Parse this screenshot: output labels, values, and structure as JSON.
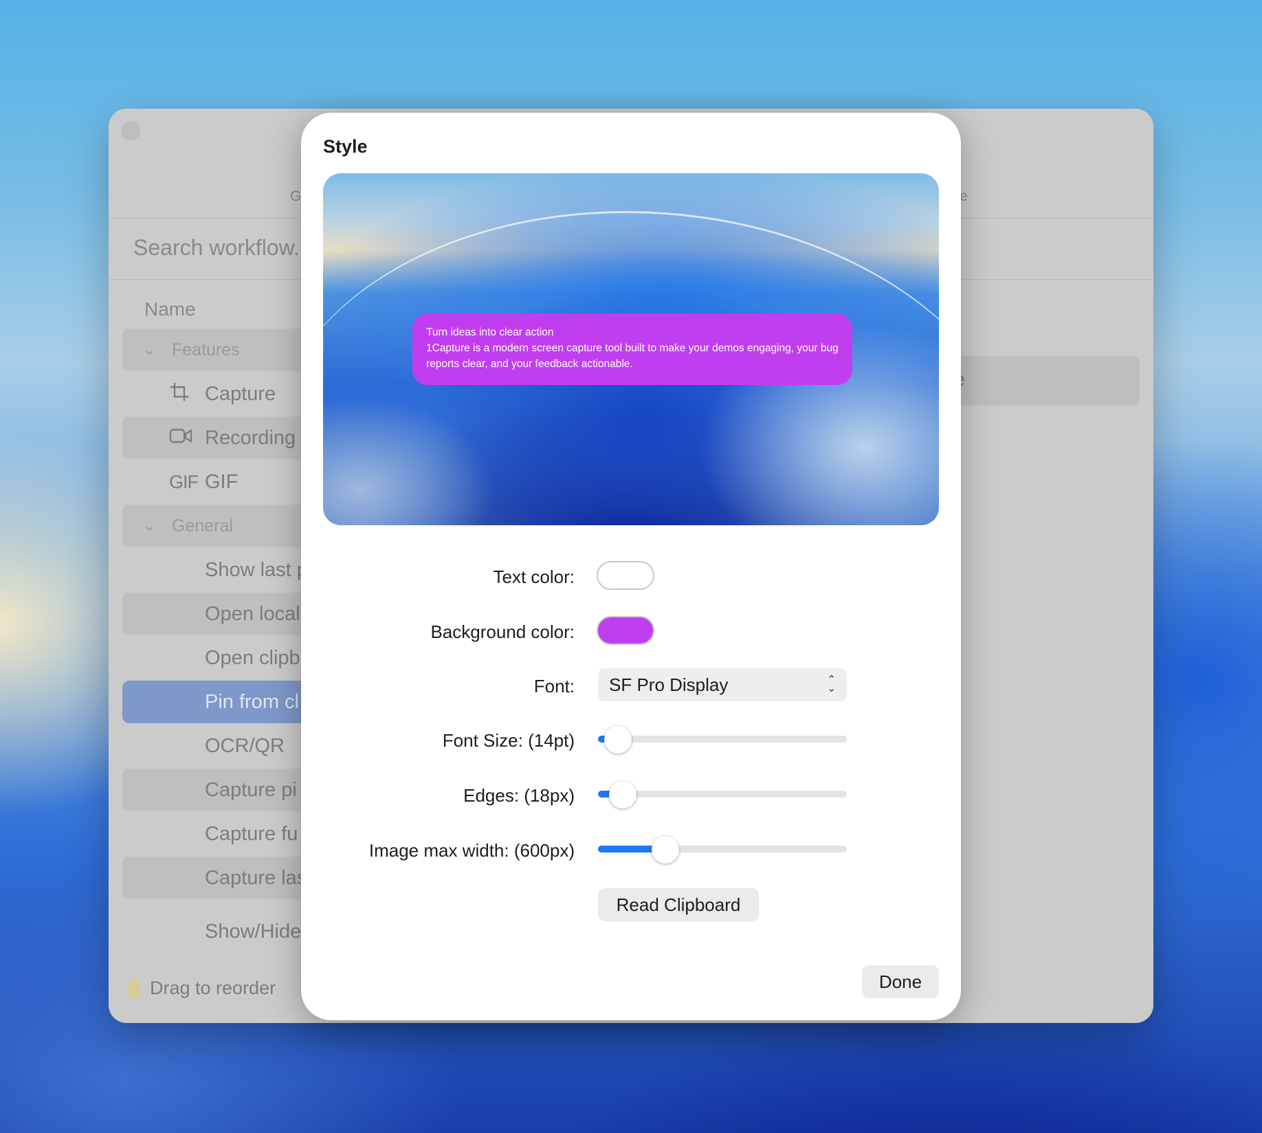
{
  "background_window": {
    "tab_left_fragment": "G",
    "tab_right_fragment": "e",
    "search_placeholder": "Search workflow...",
    "column_header": "Name",
    "rows": [
      {
        "label": "Features",
        "kind": "group"
      },
      {
        "label": "Capture",
        "icon": "crop-icon"
      },
      {
        "label": "Recording",
        "icon": "video-camera-icon"
      },
      {
        "label": "GIF",
        "icon": "gif-icon",
        "icon_text": "GIF"
      },
      {
        "label": "General",
        "kind": "group"
      },
      {
        "label": "Show last p"
      },
      {
        "label": "Open local"
      },
      {
        "label": "Open clipb"
      },
      {
        "label": "Pin from cl",
        "selected": true
      },
      {
        "label": "OCR/QR"
      },
      {
        "label": "Capture pi"
      },
      {
        "label": "Capture fu"
      },
      {
        "label": "Capture las"
      },
      {
        "label": "Show/Hide"
      }
    ],
    "right_item_fragment": "yle",
    "footer_tip": "Drag to reorder"
  },
  "modal": {
    "title": "Style",
    "preview_bubble": {
      "title": "Turn ideas into clear action",
      "body": "1Capture is a modern screen capture tool built to make your demos engaging, your bug reports clear, and your feedback actionable."
    },
    "fields": {
      "text_color_label": "Text color:",
      "text_color_value": "#ffffff",
      "background_color_label": "Background color:",
      "background_color_value": "#c13ef0",
      "font_label": "Font:",
      "font_value": "SF Pro Display",
      "font_size_label": "Font Size: (14pt)",
      "font_size_fraction": 0.08,
      "edges_label": "Edges: (18px)",
      "edges_fraction": 0.1,
      "image_max_width_label": "Image max width: (600px)",
      "image_max_width_fraction": 0.27
    },
    "read_clipboard_button": "Read Clipboard",
    "done_button": "Done"
  },
  "colors": {
    "accent": "#1c7bf3",
    "selected_row": "#7d98c9",
    "bubble": "#c13ef0"
  }
}
